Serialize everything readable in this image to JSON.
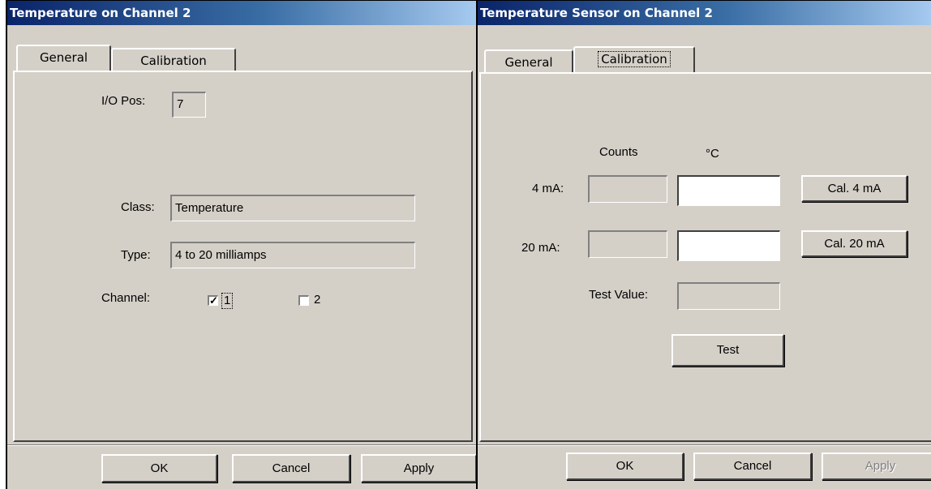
{
  "left": {
    "title": "Temperature on Channel 2",
    "tabs": [
      {
        "label": "General",
        "active": true
      },
      {
        "label": "Calibration",
        "active": false
      }
    ],
    "io_pos": {
      "label": "I/O Pos:",
      "value": "7"
    },
    "class": {
      "label": "Class:",
      "value": "Temperature"
    },
    "type": {
      "label": "Type:",
      "value": "4 to 20 milliamps"
    },
    "channel": {
      "label": "Channel:",
      "options": [
        {
          "label": "1",
          "checked": true
        },
        {
          "label": "2",
          "checked": false
        }
      ]
    },
    "buttons": {
      "ok": "OK",
      "cancel": "Cancel",
      "apply": "Apply"
    }
  },
  "right": {
    "title": "Temperature Sensor on Channel 2",
    "tabs": [
      {
        "label": "General",
        "active": false
      },
      {
        "label": "Calibration",
        "active": true
      }
    ],
    "headers": {
      "counts": "Counts",
      "unit": "°C"
    },
    "rows": [
      {
        "label": "4 mA:",
        "counts": "",
        "celsius": "",
        "button": "Cal. 4 mA"
      },
      {
        "label": "20 mA:",
        "counts": "",
        "celsius": "",
        "button": "Cal. 20 mA"
      }
    ],
    "test_value": {
      "label": "Test Value:",
      "value": ""
    },
    "test_button": "Test",
    "buttons": {
      "ok": "OK",
      "cancel": "Cancel",
      "apply": "Apply",
      "apply_disabled": true
    }
  }
}
